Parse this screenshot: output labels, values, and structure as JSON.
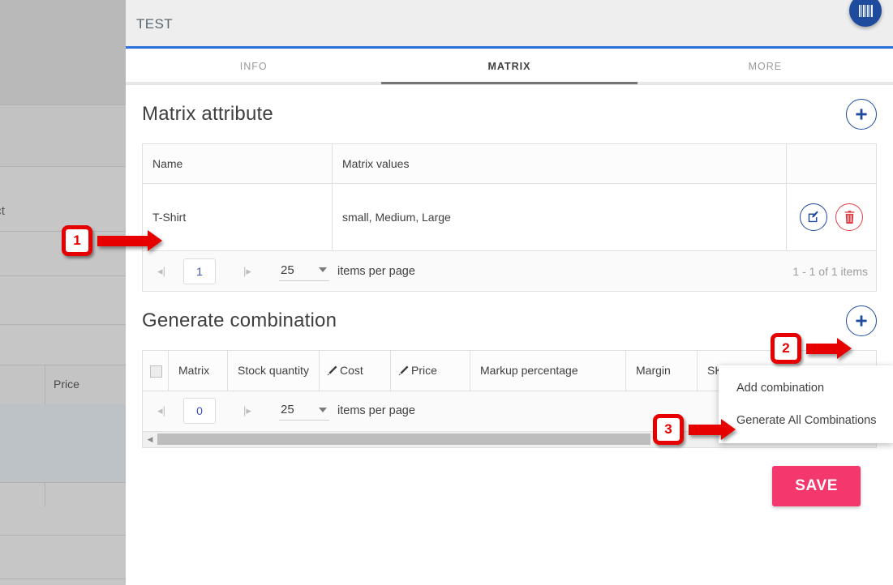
{
  "backdrop": {
    "select_label": "lect",
    "price_header": "Price"
  },
  "panel": {
    "title": "TEST",
    "barcode_icon": "barcode-icon"
  },
  "tabs": [
    {
      "label": "INFO",
      "active": false
    },
    {
      "label": "MATRIX",
      "active": true
    },
    {
      "label": "MORE",
      "active": false
    }
  ],
  "matrix_attribute": {
    "title": "Matrix attribute",
    "add_icon": "plus-icon",
    "columns": [
      "Name",
      "Matrix values",
      ""
    ],
    "rows": [
      {
        "name": "T-Shirt",
        "values": "small, Medium, Large",
        "edit_icon": "edit-icon",
        "delete_icon": "trash-icon"
      }
    ],
    "pager": {
      "first_icon": "first-page-icon",
      "last_icon": "last-page-icon",
      "page": "1",
      "page_size": "25",
      "items_per_page_label": "items per page",
      "range": "1 - 1 of 1 items"
    }
  },
  "generate_combination": {
    "title": "Generate combination",
    "add_icon": "plus-icon",
    "columns": [
      {
        "label": "",
        "type": "checkbox"
      },
      {
        "label": "Matrix",
        "type": "text"
      },
      {
        "label": "Stock quantity",
        "type": "text"
      },
      {
        "label": "Cost",
        "type": "wand"
      },
      {
        "label": "Price",
        "type": "wand"
      },
      {
        "label": "Markup percentage",
        "type": "text"
      },
      {
        "label": "Margin",
        "type": "text"
      },
      {
        "label": "SKU",
        "type": "text"
      }
    ],
    "pager": {
      "first_icon": "first-page-icon",
      "last_icon": "last-page-icon",
      "page": "0",
      "page_size": "25",
      "items_per_page_label": "items per page"
    },
    "scrollbar": {
      "left_icon": "scroll-left-icon",
      "right_icon": "scroll-right-icon"
    },
    "menu": [
      "Add combination",
      "Generate All Combinations"
    ]
  },
  "footer": {
    "save_label": "SAVE"
  },
  "annotations": [
    {
      "number": "1"
    },
    {
      "number": "2"
    },
    {
      "number": "3"
    }
  ],
  "colors": {
    "accent_blue": "#2a6fdb",
    "dark_blue": "#1e4b9e",
    "save_pink": "#f4376d",
    "delete_red": "#e0404a",
    "annotation_red": "#e60000"
  }
}
